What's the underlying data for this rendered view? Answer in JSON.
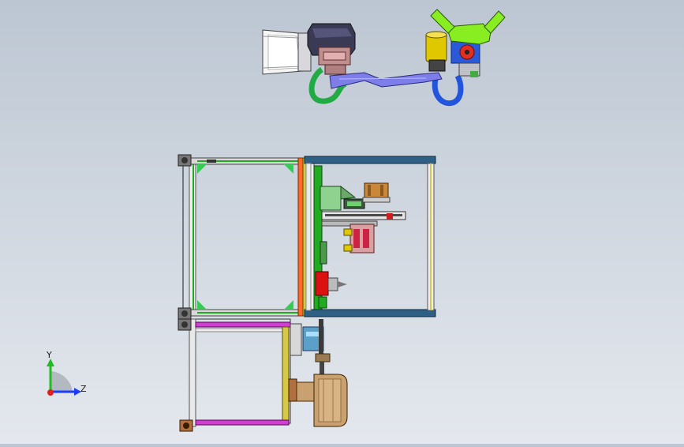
{
  "viewport": {
    "background_top": "#bcc6d2",
    "background_bottom": "#e4e8ee",
    "model": "machine-assembly-top-view"
  },
  "triad": {
    "axis_y_label": "Y",
    "axis_z_label": "Z",
    "colors": {
      "y": "#22bb22",
      "z": "#1e3cff",
      "x": "#e02020"
    }
  },
  "parts": {
    "robot_arm": {
      "colors": {
        "link": "#7e7eea",
        "cable_green": "#22aa44",
        "cable_blue": "#2255dd",
        "gripper": "#88ee22",
        "motor": "#e0c800",
        "head": "#3a3a55"
      }
    },
    "frame": {
      "colors": {
        "profile_blue": "#2e5f85",
        "profile_green": "#4cc04c",
        "bracket": "#e0e0e0",
        "orange_rail": "#ff6a2a"
      }
    },
    "spindle_drum": {
      "colors": {
        "drum": "#c9a070",
        "drum_dark": "#9e7345"
      }
    },
    "lower_frame": {
      "colors": {
        "magenta": "#d040d0",
        "yellow_rail": "#d8c84a"
      }
    }
  }
}
